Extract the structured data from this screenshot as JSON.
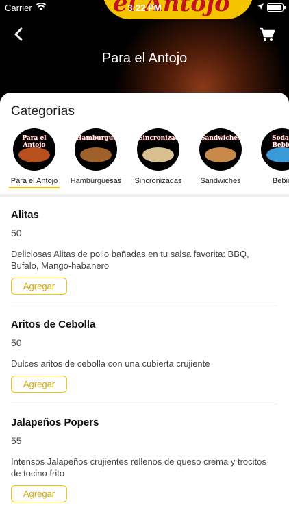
{
  "status_bar": {
    "carrier": "Carrier",
    "time": "3:22 PM"
  },
  "hero": {
    "banner_text": "el Antojo"
  },
  "header": {
    "title": "Para el Antojo"
  },
  "categories": {
    "heading": "Categorías",
    "items": [
      {
        "label": "Para el Antojo",
        "image_text": "Para el Antojo",
        "selected": true
      },
      {
        "label": "Hamburguesas",
        "image_text": "Hamburguesas"
      },
      {
        "label": "Sincronizadas",
        "image_text": "Sincronizadas"
      },
      {
        "label": "Sandwiches",
        "image_text": "Sandwiches"
      },
      {
        "label": "Bebid",
        "image_text": "Sodas Bebid"
      }
    ]
  },
  "products": [
    {
      "name": "Alitas",
      "price": "50",
      "description": "Deliciosas Alitas de pollo bañadas en tu salsa favorita: BBQ, Bufalo, Mango-habanero",
      "button": "Agregar"
    },
    {
      "name": "Aritos de Cebolla",
      "price": "50",
      "description": "Dulces aritos de cebolla con una cubierta crujiente",
      "button": "Agregar"
    },
    {
      "name": "Jalapeños Popers",
      "price": "55",
      "description": "Intensos Jalapeños crujientes rellenos de queso crema y trocitos de tocino frito",
      "button": "Agregar"
    }
  ],
  "colors": {
    "accent": "#f4c400",
    "brand_red": "#c0161b"
  }
}
